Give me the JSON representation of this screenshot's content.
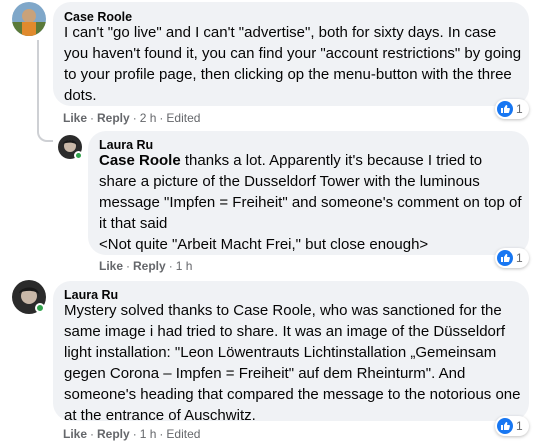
{
  "comments": [
    {
      "author": "Case Roole",
      "text": "I can't \"go live\" and I can't \"advertise\", both for sixty days. In case you haven't found it, you can find your \"account restrictions\" by going to your profile page, then clicking op the menu-button with the three dots.",
      "actions": {
        "like": "Like",
        "reply": "Reply",
        "time": "2 h",
        "edited": "Edited"
      },
      "reactions": {
        "icon": "like-icon",
        "count": "1"
      }
    },
    {
      "author": "Laura Ru",
      "tag": "Case Roole",
      "text": " thanks a lot. Apparently it's because I tried to share a picture of the Dusseldorf Tower with the luminous message \"Impfen = Freiheit\" and someone's comment on top of it that said",
      "quote": "<Not quite \"Arbeit Macht Frei,\" but close enough>",
      "actions": {
        "like": "Like",
        "reply": "Reply",
        "time": "1 h"
      },
      "reactions": {
        "icon": "like-icon",
        "count": "1"
      }
    },
    {
      "author": "Laura Ru",
      "text": "Mystery solved thanks to Case Roole, who was sanctioned for the same image i had tried to share. It was an image of the Düsseldorf light installation: \"Leon Löwentrauts Lichtinstallation „Gemeinsam gegen Corona – Impfen = Freiheit\" auf dem Rheinturm\". And someone's heading that compared the message to the notorious one at the entrance of Auschwitz.",
      "actions": {
        "like": "Like",
        "reply": "Reply",
        "time": "1 h",
        "edited": "Edited"
      },
      "reactions": {
        "icon": "like-icon",
        "count": "1"
      }
    }
  ],
  "colors": {
    "bubble": "#f0f2f5",
    "meta": "#65676b",
    "like_blue": "#1877f2",
    "online": "#31a24c"
  }
}
